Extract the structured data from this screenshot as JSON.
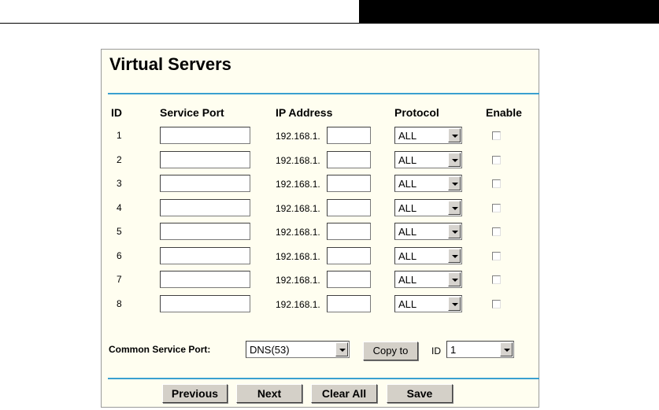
{
  "title": "Virtual Servers",
  "columns": {
    "id": "ID",
    "service_port": "Service Port",
    "ip_address": "IP Address",
    "protocol": "Protocol",
    "enable": "Enable"
  },
  "rows": [
    {
      "id": "1",
      "service_port": "",
      "ip_prefix": "192.168.1.",
      "ip_suffix": "",
      "protocol": "ALL",
      "enabled": false
    },
    {
      "id": "2",
      "service_port": "",
      "ip_prefix": "192.168.1.",
      "ip_suffix": "",
      "protocol": "ALL",
      "enabled": false
    },
    {
      "id": "3",
      "service_port": "",
      "ip_prefix": "192.168.1.",
      "ip_suffix": "",
      "protocol": "ALL",
      "enabled": false
    },
    {
      "id": "4",
      "service_port": "",
      "ip_prefix": "192.168.1.",
      "ip_suffix": "",
      "protocol": "ALL",
      "enabled": false
    },
    {
      "id": "5",
      "service_port": "",
      "ip_prefix": "192.168.1.",
      "ip_suffix": "",
      "protocol": "ALL",
      "enabled": false
    },
    {
      "id": "6",
      "service_port": "",
      "ip_prefix": "192.168.1.",
      "ip_suffix": "",
      "protocol": "ALL",
      "enabled": false
    },
    {
      "id": "7",
      "service_port": "",
      "ip_prefix": "192.168.1.",
      "ip_suffix": "",
      "protocol": "ALL",
      "enabled": false
    },
    {
      "id": "8",
      "service_port": "",
      "ip_prefix": "192.168.1.",
      "ip_suffix": "",
      "protocol": "ALL",
      "enabled": false
    }
  ],
  "common_service_port": {
    "label": "Common Service Port:",
    "value": "DNS(53)",
    "copy_button": "Copy to",
    "id_label": "ID",
    "id_value": "1"
  },
  "buttons": {
    "previous": "Previous",
    "next": "Next",
    "clear_all": "Clear All",
    "save": "Save"
  },
  "colors": {
    "panel_background": "#fffef0",
    "divider_accent": "#3aa0d0",
    "header_bar": "#000000"
  },
  "icons": [
    "dropdown-arrow-icon",
    "checkbox"
  ]
}
